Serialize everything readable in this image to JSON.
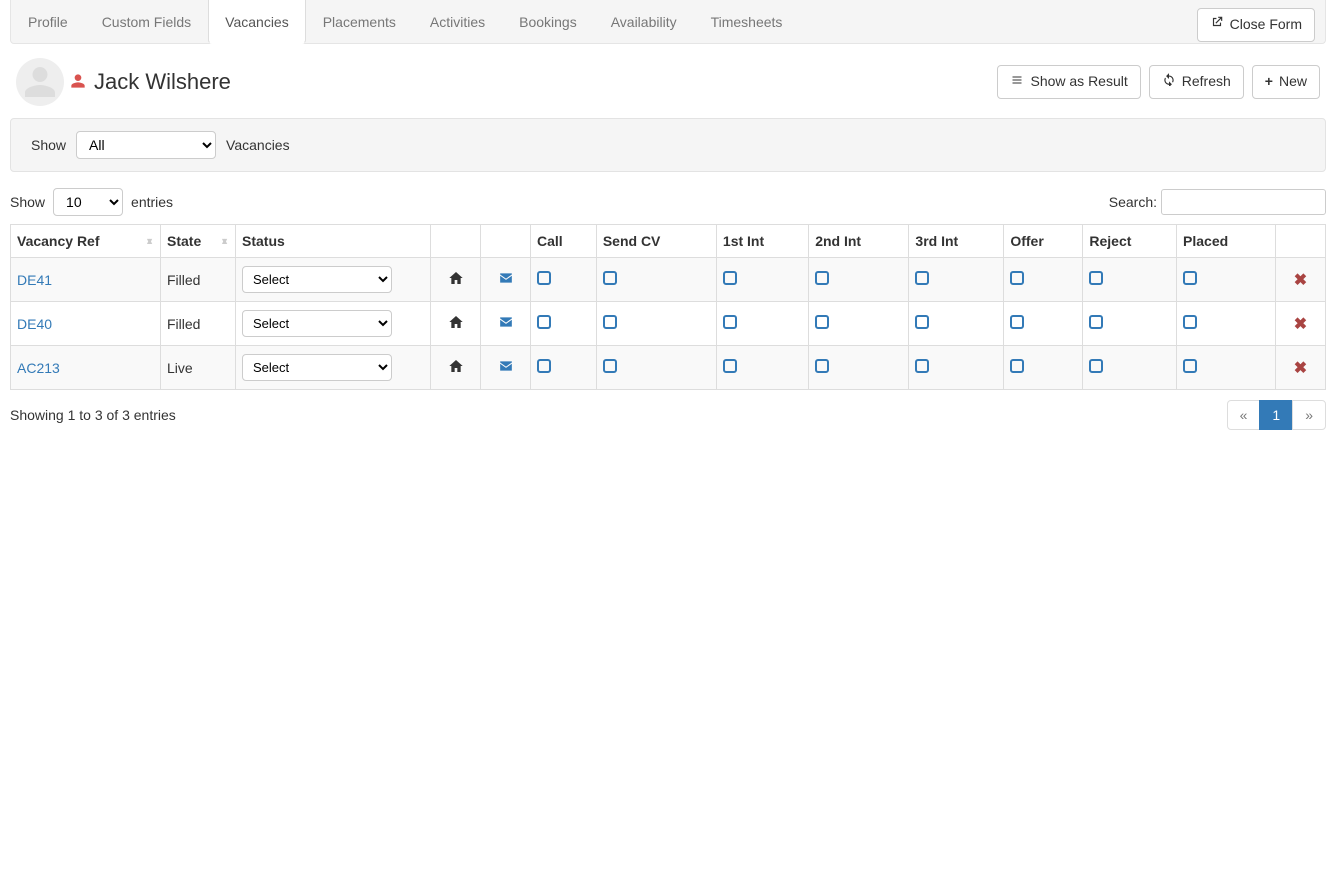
{
  "tabs": [
    "Profile",
    "Custom Fields",
    "Vacancies",
    "Placements",
    "Activities",
    "Bookings",
    "Availability",
    "Timesheets"
  ],
  "active_tab_index": 2,
  "close_form_label": "Close Form",
  "person": {
    "name": "Jack Wilshere"
  },
  "header_actions": {
    "show_as_result": "Show as Result",
    "refresh": "Refresh",
    "new": "New"
  },
  "filter": {
    "show_label": "Show",
    "dropdown_value": "All",
    "suffix": "Vacancies"
  },
  "table_controls": {
    "show_label": "Show",
    "entries_value": "10",
    "entries_label": "entries",
    "search_label": "Search:",
    "search_value": ""
  },
  "columns": [
    "Vacancy Ref",
    "State",
    "Status",
    "",
    "",
    "Call",
    "Send CV",
    "1st Int",
    "2nd Int",
    "3rd Int",
    "Offer",
    "Reject",
    "Placed",
    ""
  ],
  "status_placeholder": "Select",
  "rows": [
    {
      "ref": "DE41",
      "state": "Filled"
    },
    {
      "ref": "DE40",
      "state": "Filled"
    },
    {
      "ref": "AC213",
      "state": "Live"
    }
  ],
  "footer_info": "Showing 1 to 3 of 3 entries",
  "pagination": {
    "prev": "«",
    "pages": [
      "1"
    ],
    "active_index": 0,
    "next": "»"
  }
}
